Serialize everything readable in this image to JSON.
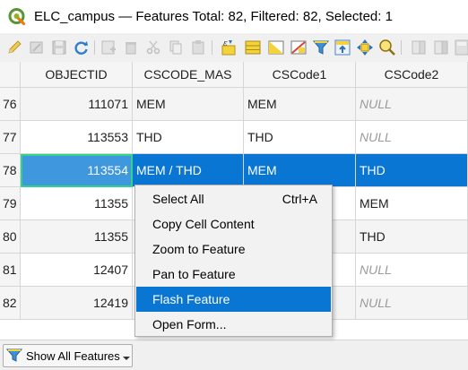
{
  "window": {
    "title": "ELC_campus — Features Total: 82, Filtered: 82, Selected: 1"
  },
  "toolbar": {
    "icons": [
      "toggle-editing-icon",
      "multi-edit-icon",
      "save-edits-icon",
      "reload-icon",
      "add-feature-icon",
      "delete-feature-icon",
      "cut-icon",
      "copy-icon",
      "paste-icon",
      "expression-select-icon",
      "select-all-icon",
      "invert-selection-icon",
      "deselect-all-icon",
      "filter-selected-icon",
      "move-selection-to-top-icon",
      "pan-to-selected-icon",
      "zoom-to-selected-icon",
      "new-field-icon",
      "delete-field-icon",
      "field-calculator-icon"
    ]
  },
  "table": {
    "columns": [
      "OBJECTID",
      "CSCODE_MAS",
      "CSCode1",
      "CSCode2"
    ],
    "rows": [
      {
        "num": "76",
        "objectid": "111071",
        "cscode_mas": "MEM",
        "cscode1": "MEM",
        "cscode2": "NULL"
      },
      {
        "num": "77",
        "objectid": "113553",
        "cscode_mas": "THD",
        "cscode1": "THD",
        "cscode2": "NULL"
      },
      {
        "num": "78",
        "objectid": "113554",
        "cscode_mas": "MEM / THD",
        "cscode1": "MEM",
        "cscode2": "THD"
      },
      {
        "num": "79",
        "objectid": "11355",
        "cscode_mas": "",
        "cscode1": "",
        "cscode2": "MEM"
      },
      {
        "num": "80",
        "objectid": "11355",
        "cscode_mas": "",
        "cscode1": "",
        "cscode2": "THD"
      },
      {
        "num": "81",
        "objectid": "12407",
        "cscode_mas": "",
        "cscode1": "",
        "cscode2": "NULL"
      },
      {
        "num": "82",
        "objectid": "12419",
        "cscode_mas": "",
        "cscode1": "",
        "cscode2": "NULL"
      }
    ],
    "selected_row": "78"
  },
  "context_menu": {
    "items": [
      {
        "label": "Select All",
        "shortcut": "Ctrl+A"
      },
      {
        "label": "Copy Cell Content",
        "shortcut": ""
      },
      {
        "label": "Zoom to Feature",
        "shortcut": ""
      },
      {
        "label": "Pan to Feature",
        "shortcut": ""
      },
      {
        "label": "Flash Feature",
        "shortcut": ""
      },
      {
        "label": "Open Form...",
        "shortcut": ""
      }
    ],
    "highlighted": "Flash Feature"
  },
  "bottom_bar": {
    "show_label": "Show All Features"
  },
  "colors": {
    "selection": "#0a76d4",
    "cell_focus_border": "#33d28a",
    "null_text": "#9a9a9a"
  }
}
